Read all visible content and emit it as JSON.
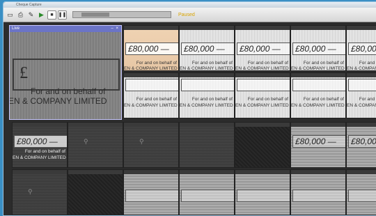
{
  "window": {
    "title": "Cheque Capture"
  },
  "toolbar": {
    "icons": [
      "image-icon",
      "print-icon",
      "edit-icon",
      "play-icon",
      "stop-icon",
      "pause-icon"
    ],
    "status": "Paused"
  },
  "live": {
    "title": "Live",
    "window_controls": "– ×",
    "pound": "£",
    "amount": "",
    "line1": "For and on behalf of",
    "line2": "EN & COMPANY LIMITED"
  },
  "cheque": {
    "amount": "£80,000 —",
    "line1": "For and on behalf of",
    "line2": "EN & COMPANY LIMITED"
  },
  "row3": {
    "amount": "£80,000 —",
    "mag": "⚲"
  }
}
